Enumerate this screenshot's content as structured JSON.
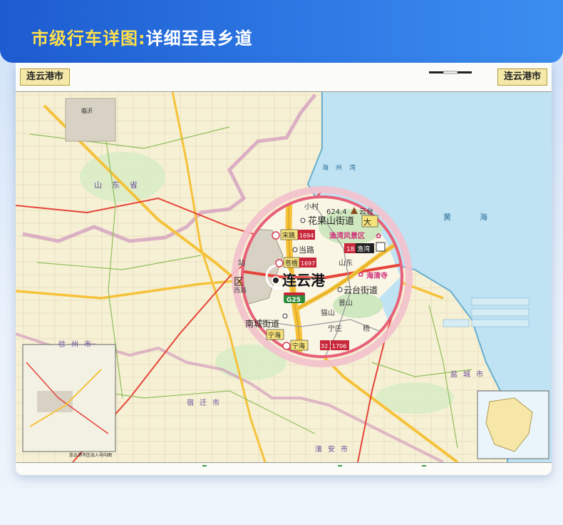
{
  "banner": {
    "title_main": "市级行车详图:",
    "title_sub": "详细至县乡道"
  },
  "map": {
    "city_left": "连云港市",
    "city_right": "连云港市",
    "small_labels": {
      "linyi": "临沂",
      "province": "山东省",
      "sea1": "海州湾",
      "sea2": "黄海",
      "jiangsu_city": "盐城市",
      "huaian": "淮安市",
      "suqian": "宿迁市",
      "xuzhou": "徐州市",
      "inset_caption": "连云港市区出入导向图"
    },
    "magnifier": {
      "labels": {
        "xiaocun": "小村",
        "peak": "624.4",
        "yuntai_short": "云台",
        "huaguoshan": "花果山街道",
        "da": "大",
        "songtiao": "宋跳",
        "songtiao_num": "1694",
        "haiwan_scenic": "渔湾风景区",
        "dangLu": "当路",
        "exit18": "18",
        "yuwan": "渔湾",
        "cangwu": "苍梧",
        "cangwu_num": "1697",
        "shandong": "山东",
        "zhan": "站",
        "qu": "区",
        "lianyungang": "连云港",
        "haiqingsi": "海清寺",
        "yuntai_jiedao": "云台街道",
        "xilu": "西路",
        "g25": "G25",
        "maoshan": "猫山",
        "pushan": "普山",
        "nanchengjiedao": "南城街道",
        "ningzhuang": "宁庄",
        "yang": "杨",
        "ninghai_top": "宁海",
        "ninghai": "宁海",
        "ninghai_exit": "32",
        "ninghai_num": "1706"
      }
    },
    "colors": {
      "land": "#f7f2d8",
      "water": "#bfe3f2",
      "magnifier_ring": "#e8607a",
      "highway": "#f6c23a",
      "national_road": "#e5453a",
      "province_border": "#c77bb6",
      "green_area": "#cfe8c0"
    }
  }
}
